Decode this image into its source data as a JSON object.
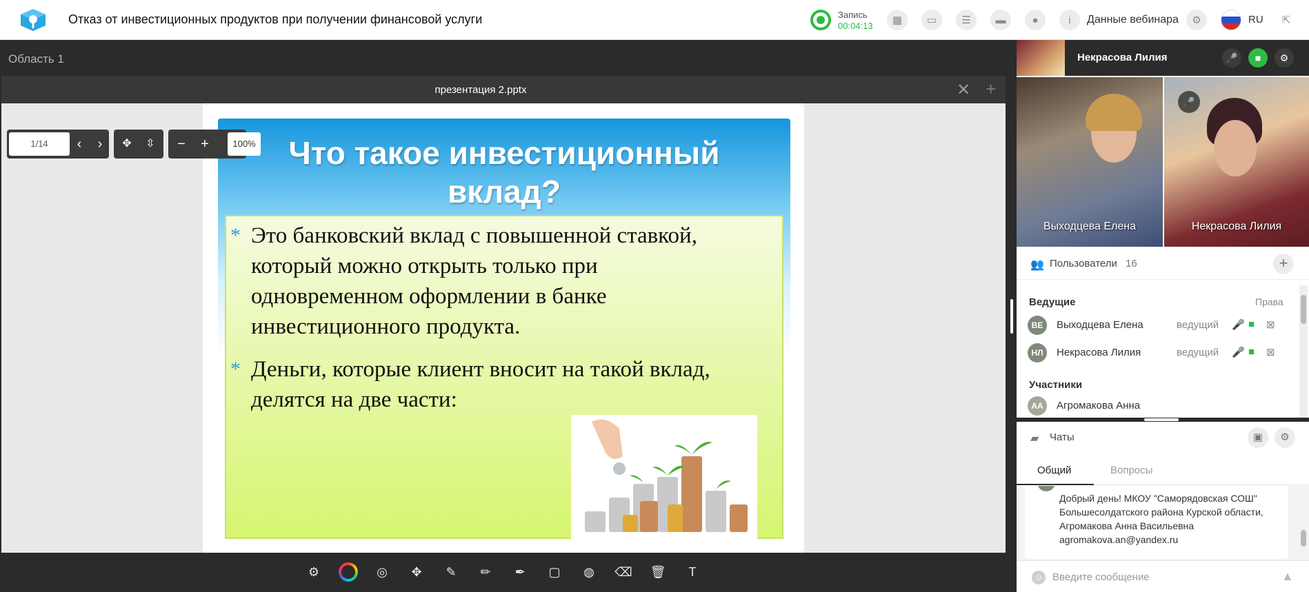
{
  "header": {
    "title": "Отказ от инвестиционных продуктов при получении финансовой услуги",
    "recording": {
      "label": "Запись",
      "time": "00:04:13",
      "color": "#2dbb45"
    },
    "webinar_data_label": "Данные вебинара",
    "language": "RU",
    "icons": [
      "apps-icon",
      "screen-icon",
      "notes-icon",
      "folder-icon",
      "user-settings-icon",
      "info-icon",
      "gear-icon"
    ]
  },
  "area": {
    "label": "Область 1"
  },
  "presentation": {
    "filename": "презентация 2.pptx",
    "page": {
      "current": "1",
      "total": "/14"
    },
    "zoom": "100%",
    "slide": {
      "title_line1": "Что такое инвестиционный",
      "title_line2": "вклад?",
      "bullets": [
        "Это банковский вклад с повышенной ставкой,\nкоторый можно открыть только при\nодновременном оформлении в банке\nинвестиционного продукта.",
        "Деньги, которые клиент вносит на такой вклад,\nделятся на две части:"
      ],
      "bullet_marker": "*"
    }
  },
  "toolbar": {
    "tools": [
      "settings-icon",
      "color-picker-icon",
      "pointer-icon",
      "move-icon",
      "brush-icon",
      "pencil-icon",
      "marker-icon",
      "rectangle-icon",
      "shape-icon",
      "eraser-icon",
      "trash-icon",
      "text-icon"
    ]
  },
  "speaker": {
    "name": "Некрасова Лилия"
  },
  "videos": [
    {
      "name": "Выходцева Елена"
    },
    {
      "name": "Некрасова Лилия"
    }
  ],
  "users": {
    "label": "Пользователи",
    "count": "16",
    "hosts_label": "Ведущие",
    "rights_label": "Права",
    "hosts": [
      {
        "initials": "ВЕ",
        "name": "Выходцева Елена",
        "role": "ведущий"
      },
      {
        "initials": "НЛ",
        "name": "Некрасова Лилия",
        "role": "ведущий"
      }
    ],
    "participants_label": "Участники",
    "participants": [
      {
        "initials": "АА",
        "name": "Агромакова Анна"
      }
    ]
  },
  "chats": {
    "label": "Чаты",
    "tabs": [
      "Общий",
      "Вопросы"
    ],
    "message": "Добрый день! МКОУ \"Саморядовская СОШ\" Большесолдатского района Курской области, Агромакова Анна Васильевна agromakova.an@yandex.ru",
    "input_placeholder": "Введите сообщение"
  },
  "colors": {
    "accent_green": "#2dbb45",
    "dark_bg": "#2b2b2b",
    "slide_box": "#d6f570",
    "slide_header": "#1596dd"
  }
}
